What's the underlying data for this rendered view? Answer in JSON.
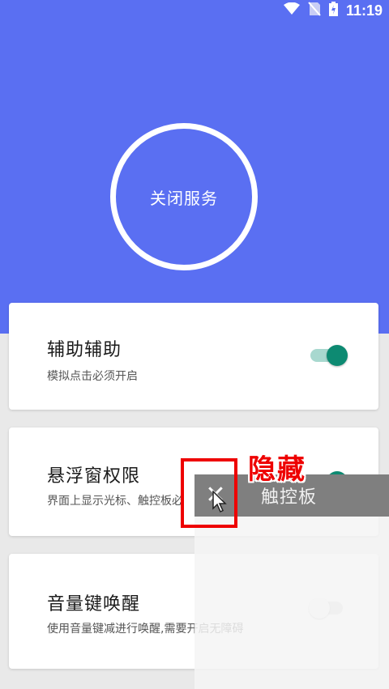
{
  "status_bar": {
    "time": "11:19",
    "icons": [
      "wifi-icon",
      "no-sim-icon",
      "battery-charging-icon"
    ]
  },
  "hero": {
    "button_label": "关闭服务",
    "background_color": "#5a6ff2"
  },
  "settings": [
    {
      "title": "辅助辅助",
      "subtitle": "模拟点击必须开启",
      "toggle_on": true
    },
    {
      "title": "悬浮窗权限",
      "subtitle": "界面上显示光标、触控板必",
      "toggle_on": true
    },
    {
      "title": "音量键唤醒",
      "subtitle": "使用音量键减进行唤醒,需要开启无障碍",
      "toggle_on": false
    }
  ],
  "floating_touchpad": {
    "close_symbol": "✕",
    "label": "触控板"
  },
  "annotation": {
    "label": "隐藏",
    "color": "#ee0000"
  },
  "accent_color": "#0d8a72"
}
